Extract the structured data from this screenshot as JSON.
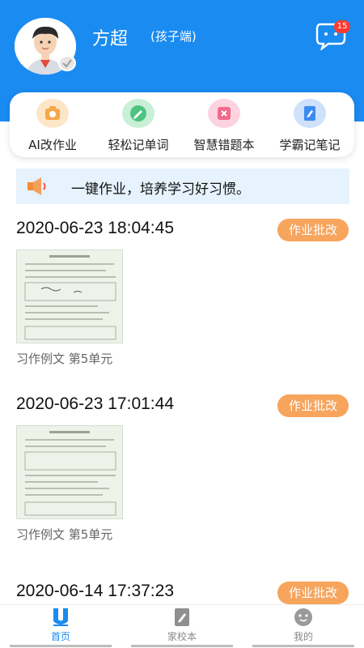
{
  "profile": {
    "name": "方超",
    "role": "(孩子端)"
  },
  "messages": {
    "badge_count": "15"
  },
  "shortcuts": [
    {
      "label": "AI改作业",
      "icon": "ai-grading-icon",
      "color": "#f6a74a"
    },
    {
      "label": "轻松记单词",
      "icon": "pencil-icon",
      "color": "#4cc47f"
    },
    {
      "label": "智慧错题本",
      "icon": "wrong-question-book-icon",
      "color": "#f26a8d"
    },
    {
      "label": "学霸记笔记",
      "icon": "notebook-icon",
      "color": "#3d8bf2"
    }
  ],
  "notice": {
    "text": "一键作业，培养学习好习惯。",
    "icon": "speaker-icon"
  },
  "records": [
    {
      "time": "2020-06-23 18:04:45",
      "tag": "作业批改",
      "caption": "习作例文  第5单元"
    },
    {
      "time": "2020-06-23 17:01:44",
      "tag": "作业批改",
      "caption": "习作例文  第5单元"
    },
    {
      "time": "2020-06-14 17:37:23",
      "tag": "作业批改"
    }
  ],
  "tabs": [
    {
      "label": "首页",
      "icon": "home-icon",
      "active": true
    },
    {
      "label": "家校本",
      "icon": "home-school-book-icon",
      "active": false
    },
    {
      "label": "我的",
      "icon": "profile-icon",
      "active": false
    }
  ],
  "colors": {
    "primary": "#1a8bf0",
    "tag": "#f7a45c",
    "notice_bg": "#e6f2fd"
  }
}
